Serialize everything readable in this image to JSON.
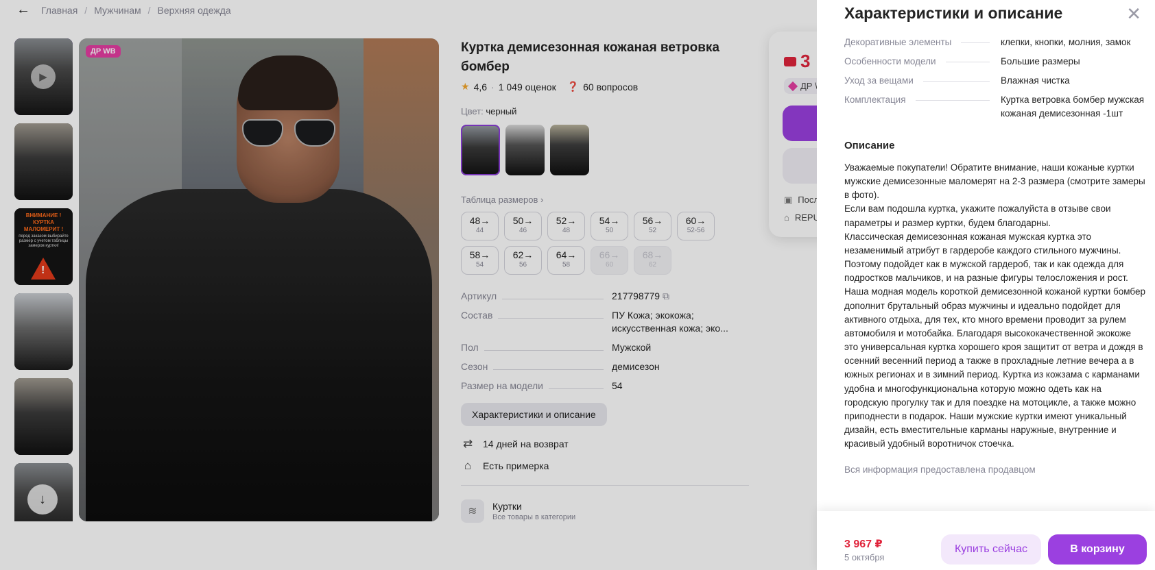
{
  "breadcrumb": {
    "items": [
      "Главная",
      "Мужчинам",
      "Верхняя одежда"
    ]
  },
  "gallery": {
    "badge": "ДР WB",
    "warning_thumb": {
      "headline": "ВНИМАНИЕ ! КУРТКА МАЛОМЕРИТ !",
      "subtext": "перед заказом выбирайте размер с учетом таблицы замеров куртки!"
    }
  },
  "product": {
    "title": "Куртка демисезонная кожаная ветровка бомбер",
    "rating": "4,6",
    "reviews": "1 049 оценок",
    "questions": "60 вопросов",
    "color_label": "Цвет:",
    "color_value": "черный",
    "size_table_link": "Таблица размеров",
    "sizes": [
      {
        "label": "48",
        "sub": "44",
        "available": true
      },
      {
        "label": "50",
        "sub": "46",
        "available": true
      },
      {
        "label": "52",
        "sub": "48",
        "available": true
      },
      {
        "label": "54",
        "sub": "50",
        "available": true
      },
      {
        "label": "56",
        "sub": "52",
        "available": true
      },
      {
        "label": "60",
        "sub": "52-56",
        "available": true
      },
      {
        "label": "58",
        "sub": "54",
        "available": true
      },
      {
        "label": "62",
        "sub": "56",
        "available": true
      },
      {
        "label": "64",
        "sub": "58",
        "available": true
      },
      {
        "label": "66",
        "sub": "60",
        "available": false
      },
      {
        "label": "68",
        "sub": "62",
        "available": false
      }
    ],
    "props": [
      {
        "k": "Артикул",
        "v": "217798779"
      },
      {
        "k": "Состав",
        "v": "ПУ Кожа; экокожа; искусственная кожа; эко..."
      },
      {
        "k": "Пол",
        "v": "Мужской"
      },
      {
        "k": "Сезон",
        "v": "демисезон"
      },
      {
        "k": "Размер на модели",
        "v": "54"
      }
    ],
    "chars_button": "Характеристики и описание",
    "return_text": "14 дней на возврат",
    "fitting_text": "Есть примерка",
    "category_title": "Куртки",
    "category_sub": "Все товары в категории"
  },
  "buy_card": {
    "price_partial": "3",
    "badge_partial": "ДР \\",
    "row1_partial": "Посл",
    "row2_partial": "REPU"
  },
  "drawer": {
    "title": "Характеристики и описание",
    "specs": [
      {
        "k": "Декоративные элементы",
        "v": "клепки, кнопки, молния, замок"
      },
      {
        "k": "Особенности модели",
        "v": "Большие размеры"
      },
      {
        "k": "Уход за вещами",
        "v": "Влажная чистка"
      },
      {
        "k": "Комплектация",
        "v": "Куртка ветровка бомбер мужская кожаная демисезонная -1шт"
      }
    ],
    "description_title": "Описание",
    "description": "Уважаемые покупатели! Обратите внимание, наши кожаные куртки мужские демисезонные маломерят на 2-3 размера (смотрите замеры в фото).\nЕсли вам подошла куртка, укажите пожалуйста в отзыве свои параметры и размер куртки, будем благодарны.\nКлассическая демисезонная кожаная мужская куртка это незаменимый атрибут в гардеробе каждого стильного мужчины. Поэтому подойдет как в мужской гардероб, так и как одежда для подростков мальчиков, и на разные фигуры телосложения и рост. Наша модная модель короткой демисезонной кожаной куртки бомбер дополнит брутальный образ мужчины и идеально подойдет для активного отдыха, для тех, кто много времени проводит за рулем автомобиля и мотобайка. Благодаря высококачественной экокоже это универсальная куртка хорошего кроя защитит от ветра и дождя в осенний весенний период а также в прохладные летние вечера а в южных регионах и в зимний период. Куртка из кожзама с карманами удобна и многофункциональна которую можно одеть как на городскую прогулку так и для поездке на мотоцикле, а также можно приподнести в подарок. Наши мужские куртки имеют уникальный дизайн, есть вместительные карманы наружные, внутренние и красивый удобный воротничок стоечка.",
    "seller_note": "Вся информация предоставлена продавцом",
    "footer": {
      "price": "3 967 ₽",
      "date": "5 октября",
      "buy_now": "Купить сейчас",
      "add_to_cart": "В корзину"
    }
  },
  "colors": {
    "accent": "#9b40e0",
    "price": "#e0243b",
    "badge": "#e53ea3"
  }
}
